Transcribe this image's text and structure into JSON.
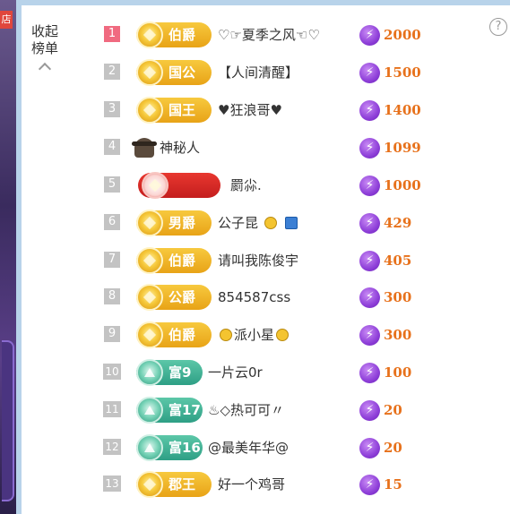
{
  "collapse": {
    "label_line1": "收起",
    "label_line2": "榜单"
  },
  "help": {
    "icon_text": "?"
  },
  "left_tag": "店",
  "rows": [
    {
      "rank": "1",
      "badge": "伯爵",
      "badge_type": "gold",
      "name": "♡☞夏季之风☜♡",
      "score": "2000"
    },
    {
      "rank": "2",
      "badge": "国公",
      "badge_type": "gold",
      "name": "【人间清醒】",
      "score": "1500"
    },
    {
      "rank": "3",
      "badge": "国王",
      "badge_type": "gold",
      "name": "♥狂浪哥♥",
      "score": "1400"
    },
    {
      "rank": "4",
      "badge": "",
      "badge_type": "mystery",
      "name": "神秘人",
      "score": "1099"
    },
    {
      "rank": "5",
      "badge": "",
      "badge_type": "red",
      "name": "罽尛.",
      "score": "1000"
    },
    {
      "rank": "6",
      "badge": "男爵",
      "badge_type": "gold",
      "name": "公子昆",
      "score": "429"
    },
    {
      "rank": "7",
      "badge": "伯爵",
      "badge_type": "gold",
      "name": "请叫我陈俊宇",
      "score": "405"
    },
    {
      "rank": "8",
      "badge": "公爵",
      "badge_type": "gold",
      "name": "854587css",
      "score": "300"
    },
    {
      "rank": "9",
      "badge": "伯爵",
      "badge_type": "gold",
      "name": "派小星",
      "score": "300"
    },
    {
      "rank": "10",
      "badge": "富9",
      "badge_type": "teal",
      "name": "一片云0r",
      "score": "100"
    },
    {
      "rank": "11",
      "badge": "富17",
      "badge_type": "teal",
      "name": "♨◇热可可〃",
      "score": "20"
    },
    {
      "rank": "12",
      "badge": "富16",
      "badge_type": "teal",
      "name": "@最美年华@",
      "score": "20"
    },
    {
      "rank": "13",
      "badge": "郡王",
      "badge_type": "gold",
      "name": "好一个鸡哥",
      "score": "15"
    }
  ]
}
